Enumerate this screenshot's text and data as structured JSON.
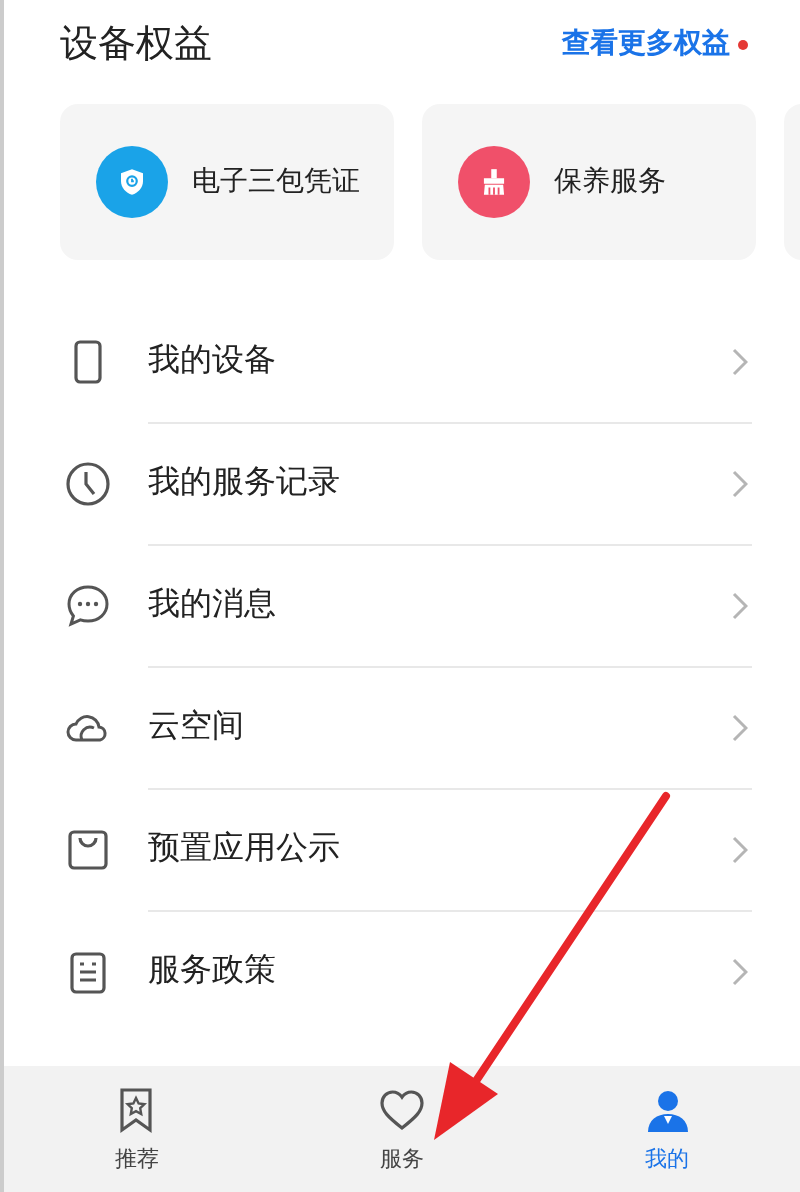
{
  "header": {
    "title": "设备权益",
    "more_link": "查看更多权益",
    "more_badge": true
  },
  "benefit_cards": [
    {
      "label": "电子三包凭证",
      "color": "#1aa3e8"
    },
    {
      "label": "保养服务",
      "color": "#f0506a"
    }
  ],
  "menu_items": [
    {
      "label": "我的设备"
    },
    {
      "label": "我的服务记录"
    },
    {
      "label": "我的消息"
    },
    {
      "label": "云空间"
    },
    {
      "label": "预置应用公示"
    },
    {
      "label": "服务政策"
    }
  ],
  "bottom_nav": [
    {
      "label": "推荐",
      "selected": false
    },
    {
      "label": "服务",
      "selected": false
    },
    {
      "label": "我的",
      "selected": true
    }
  ]
}
